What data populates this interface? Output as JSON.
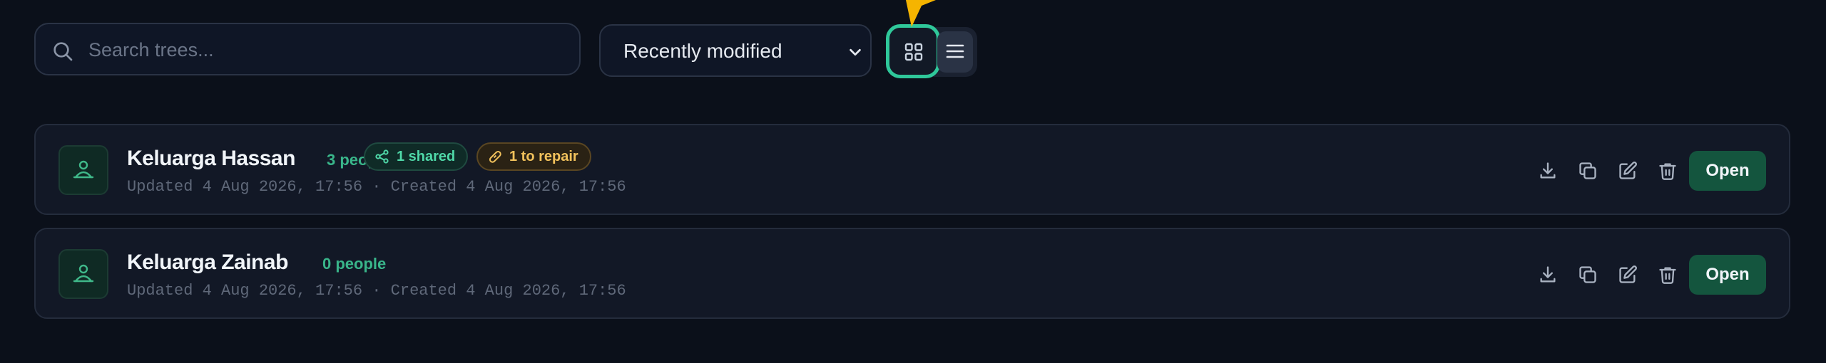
{
  "search": {
    "placeholder": "Search trees...",
    "value": ""
  },
  "sort": {
    "selected": "Recently modified"
  },
  "view": {
    "active": "grid"
  },
  "trees": [
    {
      "name": "Keluarga Hassan",
      "people": "3 people",
      "shared": "1 shared",
      "repair": "1 to repair",
      "meta": "Updated 4 Aug 2026, 17:56 · Created 4 Aug 2026, 17:56",
      "open_label": "Open"
    },
    {
      "name": "Keluarga Zainab",
      "people": "0 people",
      "meta": "Updated 4 Aug 2026, 17:56 · Created 4 Aug 2026, 17:56",
      "open_label": "Open"
    }
  ],
  "colors": {
    "accent": "#2fc89a",
    "open_button": "#14553e",
    "shared": "#4fd8a8",
    "repair": "#f2c25c",
    "cursor": "#f5b400"
  }
}
